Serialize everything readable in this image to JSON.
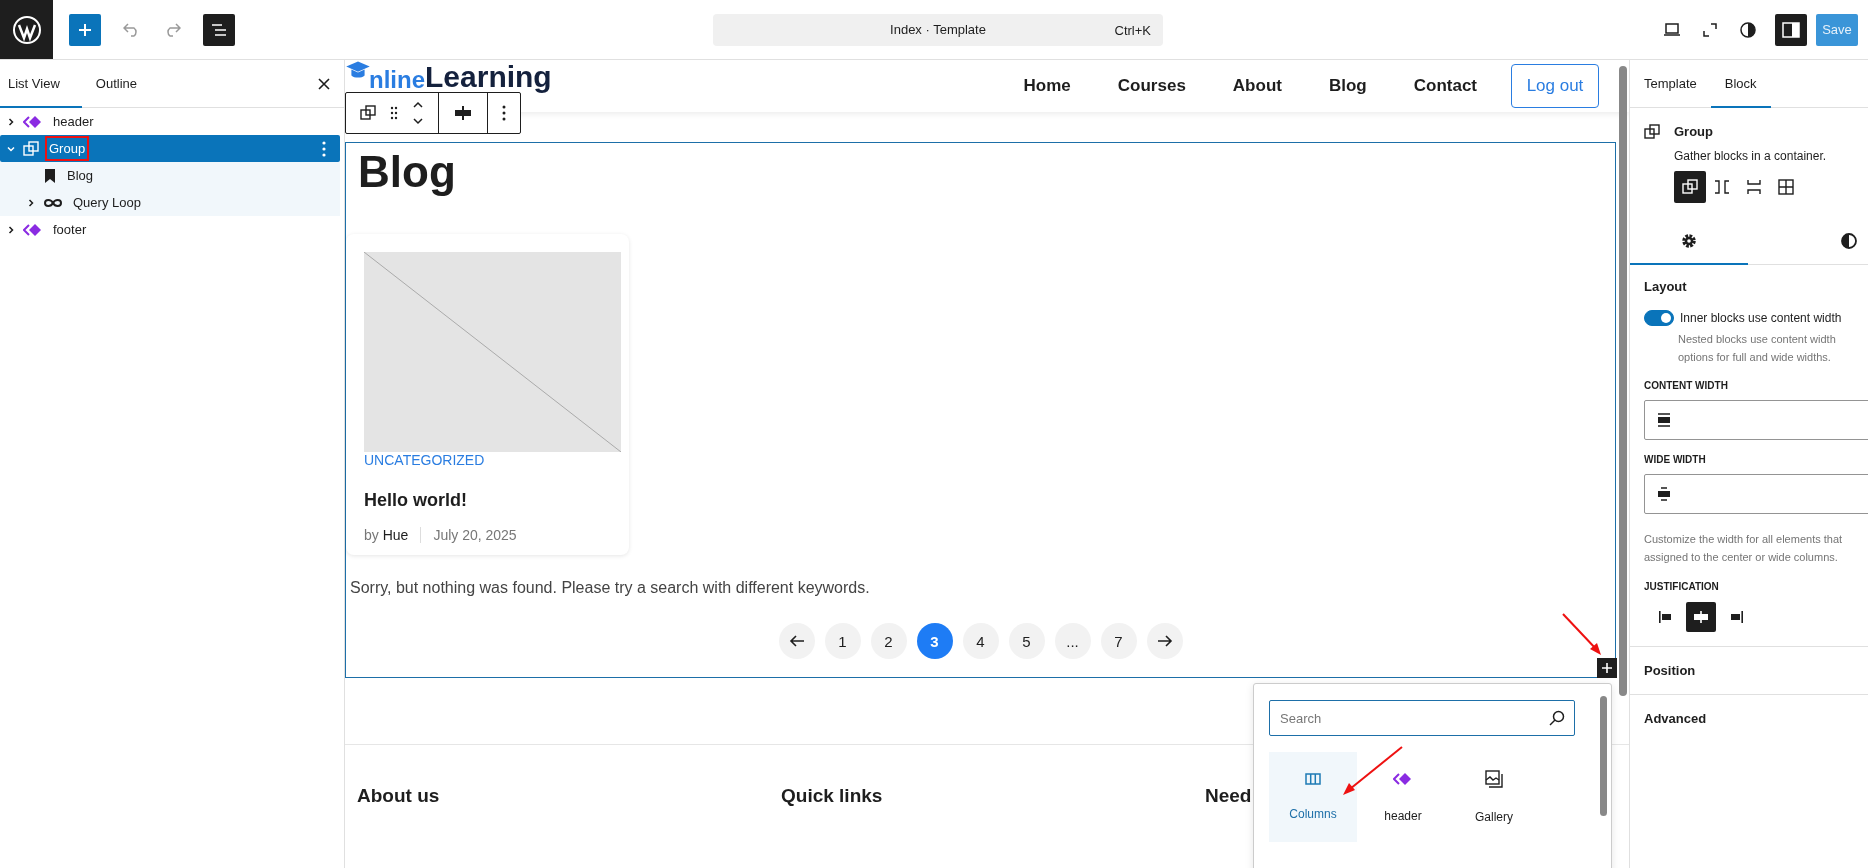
{
  "topbar": {
    "command_title": "Index · Template",
    "shortcut": "Ctrl+K",
    "save": "Save"
  },
  "list_view": {
    "tabs": [
      {
        "label": "List View",
        "selected": true
      },
      {
        "label": "Outline",
        "selected": false
      }
    ],
    "tree": [
      {
        "label": "header",
        "kind": "template-part",
        "expanded": false,
        "selected": false,
        "annotated": false
      },
      {
        "label": "Group",
        "kind": "group",
        "expanded": true,
        "selected": true,
        "annotated": true,
        "children": [
          {
            "label": "Blog",
            "kind": "heading",
            "selected": false
          },
          {
            "label": "Query Loop",
            "kind": "query-loop",
            "expanded": false,
            "selected": false
          }
        ]
      },
      {
        "label": "footer",
        "kind": "template-part",
        "expanded": false,
        "selected": false,
        "annotated": false
      }
    ]
  },
  "site_header": {
    "logo_part1": "nline",
    "logo_part2": "Learning",
    "nav": [
      "Home",
      "Courses",
      "About",
      "Blog",
      "Contact"
    ],
    "button": "Log out"
  },
  "group": {
    "heading": "Blog",
    "posts": [
      {
        "category": "UNCATEGORIZED",
        "title": "Hello world!",
        "by": "by",
        "author": "Hue",
        "date": "July 20, 2025"
      }
    ],
    "message": "Sorry, but nothing was found. Please try a search with different keywords.",
    "pagination": [
      {
        "kind": "prev",
        "selected": false
      },
      {
        "kind": "page",
        "label": "1",
        "selected": false
      },
      {
        "kind": "page",
        "label": "2",
        "selected": false
      },
      {
        "kind": "page",
        "label": "3",
        "selected": true
      },
      {
        "kind": "page",
        "label": "4",
        "selected": false
      },
      {
        "kind": "page",
        "label": "5",
        "selected": false
      },
      {
        "kind": "page",
        "label": "...",
        "selected": false
      },
      {
        "kind": "page",
        "label": "7",
        "selected": false
      },
      {
        "kind": "next",
        "selected": false
      }
    ]
  },
  "footer_headings": [
    "About us",
    "Quick links",
    "Need"
  ],
  "inserter": {
    "placeholder": "Search",
    "items": [
      {
        "label": "Columns",
        "kind": "columns",
        "selected": true
      },
      {
        "label": "header",
        "kind": "template-part",
        "selected": false
      },
      {
        "label": "Gallery",
        "kind": "gallery",
        "selected": false
      }
    ]
  },
  "settings": {
    "tabs": [
      {
        "label": "Template",
        "selected": false
      },
      {
        "label": "Block",
        "selected": true
      }
    ],
    "block": {
      "name": "Group",
      "description": "Gather blocks in a container."
    },
    "variations": [
      {
        "kind": "group",
        "selected": true
      },
      {
        "kind": "row",
        "selected": false
      },
      {
        "kind": "stack",
        "selected": false
      },
      {
        "kind": "grid",
        "selected": false
      }
    ],
    "subtabs": [
      {
        "kind": "settings",
        "selected": true
      },
      {
        "kind": "styles",
        "selected": false
      }
    ],
    "layout": {
      "title": "Layout",
      "toggle_label": "Inner blocks use content width",
      "toggle_on": true,
      "help": [
        "Nested blocks use content width",
        "options for full and wide widths."
      ],
      "content_width": "CONTENT WIDTH",
      "wide_width": "WIDE WIDTH",
      "customize_help": [
        "Customize the width for all elements that",
        "assigned to the center or wide columns."
      ],
      "justification": "JUSTIFICATION",
      "justify_options": [
        {
          "kind": "left",
          "selected": false
        },
        {
          "kind": "center",
          "selected": true
        },
        {
          "kind": "right",
          "selected": false
        }
      ]
    },
    "sections": [
      "Position",
      "Advanced"
    ]
  }
}
